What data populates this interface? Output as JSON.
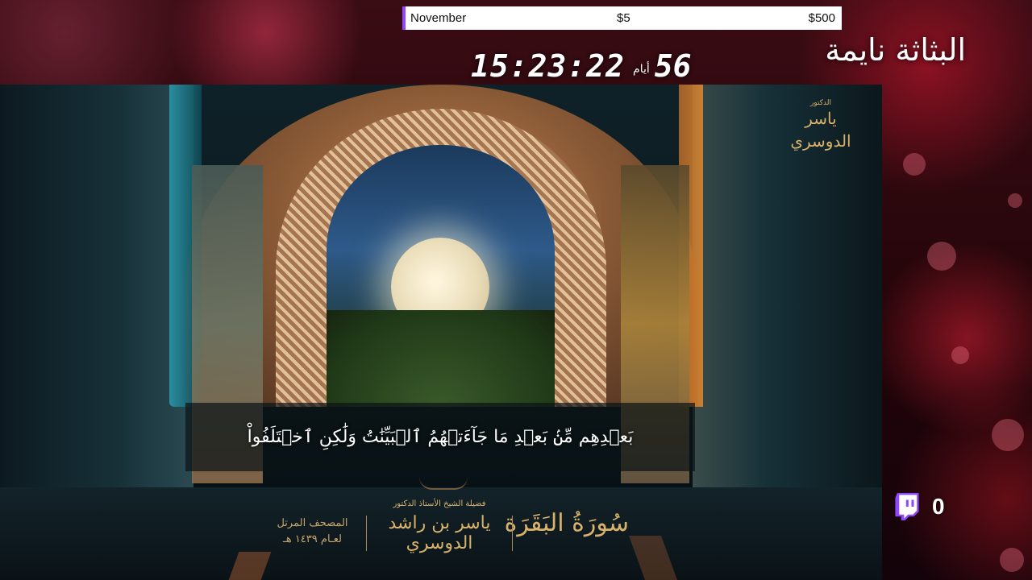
{
  "goal": {
    "month": "November",
    "current": "$5",
    "target": "$500",
    "accent_color": "#9146ff"
  },
  "countdown": {
    "time": "15:23:22",
    "days_label": "أيام",
    "days": "56"
  },
  "stream_title": "البثاثة نايمة",
  "video": {
    "verse_text": "بَعۡدِهِم مِّنۢ بَعۡدِ مَا جَآءَتۡهُمُ ٱلۡبَيِّنَٰتُ وَلَٰكِنِ ٱخۡتَلَفُواْ",
    "reciter_logo_title": "الدكتور",
    "reciter_logo_name": "ياسر الدوسري",
    "surah_name": "سُورَةُ البَقَرَة",
    "reciter_title": "فضيلة الشيخ الأستاذ الدكتور",
    "reciter_name": "ياسر بن راشد الدوسري",
    "mushaf_line1": "المصحف المرتل",
    "mushaf_line2": "لعـام ١٤٣٩ هـ"
  },
  "twitch": {
    "icon": "twitch-icon",
    "viewer_count": "0",
    "brand_color": "#9146ff"
  }
}
